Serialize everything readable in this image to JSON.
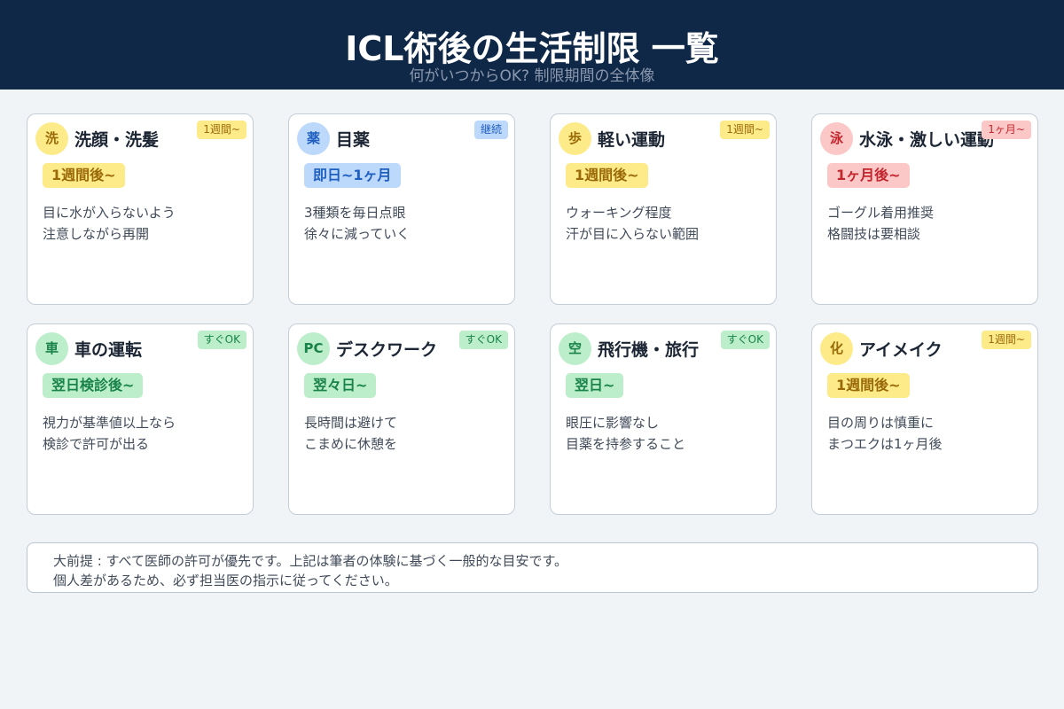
{
  "header": {
    "title": "ICL術後の生活制限 一覧",
    "subtitle": "何がいつからOK? 制限期間の全体像"
  },
  "cards": [
    {
      "icon": "洗",
      "title": "洗顔・洗髪",
      "tag": "1週間~",
      "period": "1週間後~",
      "desc": [
        "目に水が入らないよう",
        "注意しながら再開"
      ],
      "color": "#fdeb8a"
    },
    {
      "icon": "薬",
      "title": "目薬",
      "tag": "継続",
      "period": "即日~1ヶ月",
      "desc": [
        "3種類を毎日点眼",
        "徐々に減っていく"
      ],
      "color": "#bcd8fb"
    },
    {
      "icon": "歩",
      "title": "軽い運動",
      "tag": "1週間~",
      "period": "1週間後~",
      "desc": [
        "ウォーキング程度",
        "汗が目に入らない範囲"
      ],
      "color": "#fdeb8a"
    },
    {
      "icon": "泳",
      "title": "水泳・激しい運動",
      "tag": "1ヶ月~",
      "period": "1ヶ月後~",
      "desc": [
        "ゴーグル着用推奨",
        "格闘技は要相談"
      ],
      "color": "#fcc7c7"
    },
    {
      "icon": "車",
      "title": "車の運転",
      "tag": "すぐOK",
      "period": "翌日検診後~",
      "desc": [
        "視力が基準値以上なら",
        "検診で許可が出る"
      ],
      "color": "#bdeecb"
    },
    {
      "icon": "PC",
      "title": "デスクワーク",
      "tag": "すぐOK",
      "period": "翌々日~",
      "desc": [
        "長時間は避けて",
        "こまめに休憩を"
      ],
      "color": "#bdeecb"
    },
    {
      "icon": "空",
      "title": "飛行機・旅行",
      "tag": "すぐOK",
      "period": "翌日~",
      "desc": [
        "眼圧に影響なし",
        "目薬を持参すること"
      ],
      "color": "#bdeecb"
    },
    {
      "icon": "化",
      "title": "アイメイク",
      "tag": "1週間~",
      "period": "1週間後~",
      "desc": [
        "目の周りは慎重に",
        "まつエクは1ヶ月後"
      ],
      "color": "#fdeb8a"
    }
  ],
  "footer": {
    "lines": [
      "大前提 : すべて医師の許可が優先です。上記は筆者の体験に基づく一般的な目安です。",
      "個人差があるため、必ず担当医の指示に従ってください。"
    ]
  }
}
